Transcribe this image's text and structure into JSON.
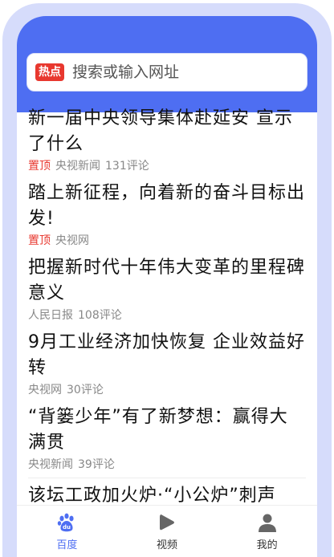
{
  "search": {
    "badge": "热点",
    "placeholder": "搜索或输入网址"
  },
  "feed": {
    "items": [
      {
        "title": "新一届中央领导集体赴延安 宣示了什么",
        "tag": "置顶",
        "source": "央视新闻",
        "comments": "131评论"
      },
      {
        "title": "踏上新征程，向着新的奋斗目标出发!",
        "tag": "置顶",
        "source": "央视网",
        "comments": ""
      },
      {
        "title": "把握新时代十年伟大变革的里程碑意义",
        "tag": "",
        "source": "人民日报",
        "comments": "108评论"
      },
      {
        "title": "9月工业经济加快恢复 企业效益好转",
        "tag": "",
        "source": "央视网",
        "comments": "30评论"
      },
      {
        "title": "“背篓少年”有了新梦想：赢得大满贯",
        "tag": "",
        "source": "央视新闻",
        "comments": "39评论"
      }
    ],
    "partial_title": "该坛工政加火炉·“小公炉”刺声"
  },
  "tabbar": {
    "tabs": [
      {
        "label": "百度",
        "icon": "baidu-paw-icon",
        "active": true
      },
      {
        "label": "视频",
        "icon": "play-icon",
        "active": false
      },
      {
        "label": "我的",
        "icon": "user-icon",
        "active": false
      }
    ]
  },
  "colors": {
    "brand_blue": "#4e6ef2",
    "hot_red": "#e8382f"
  }
}
